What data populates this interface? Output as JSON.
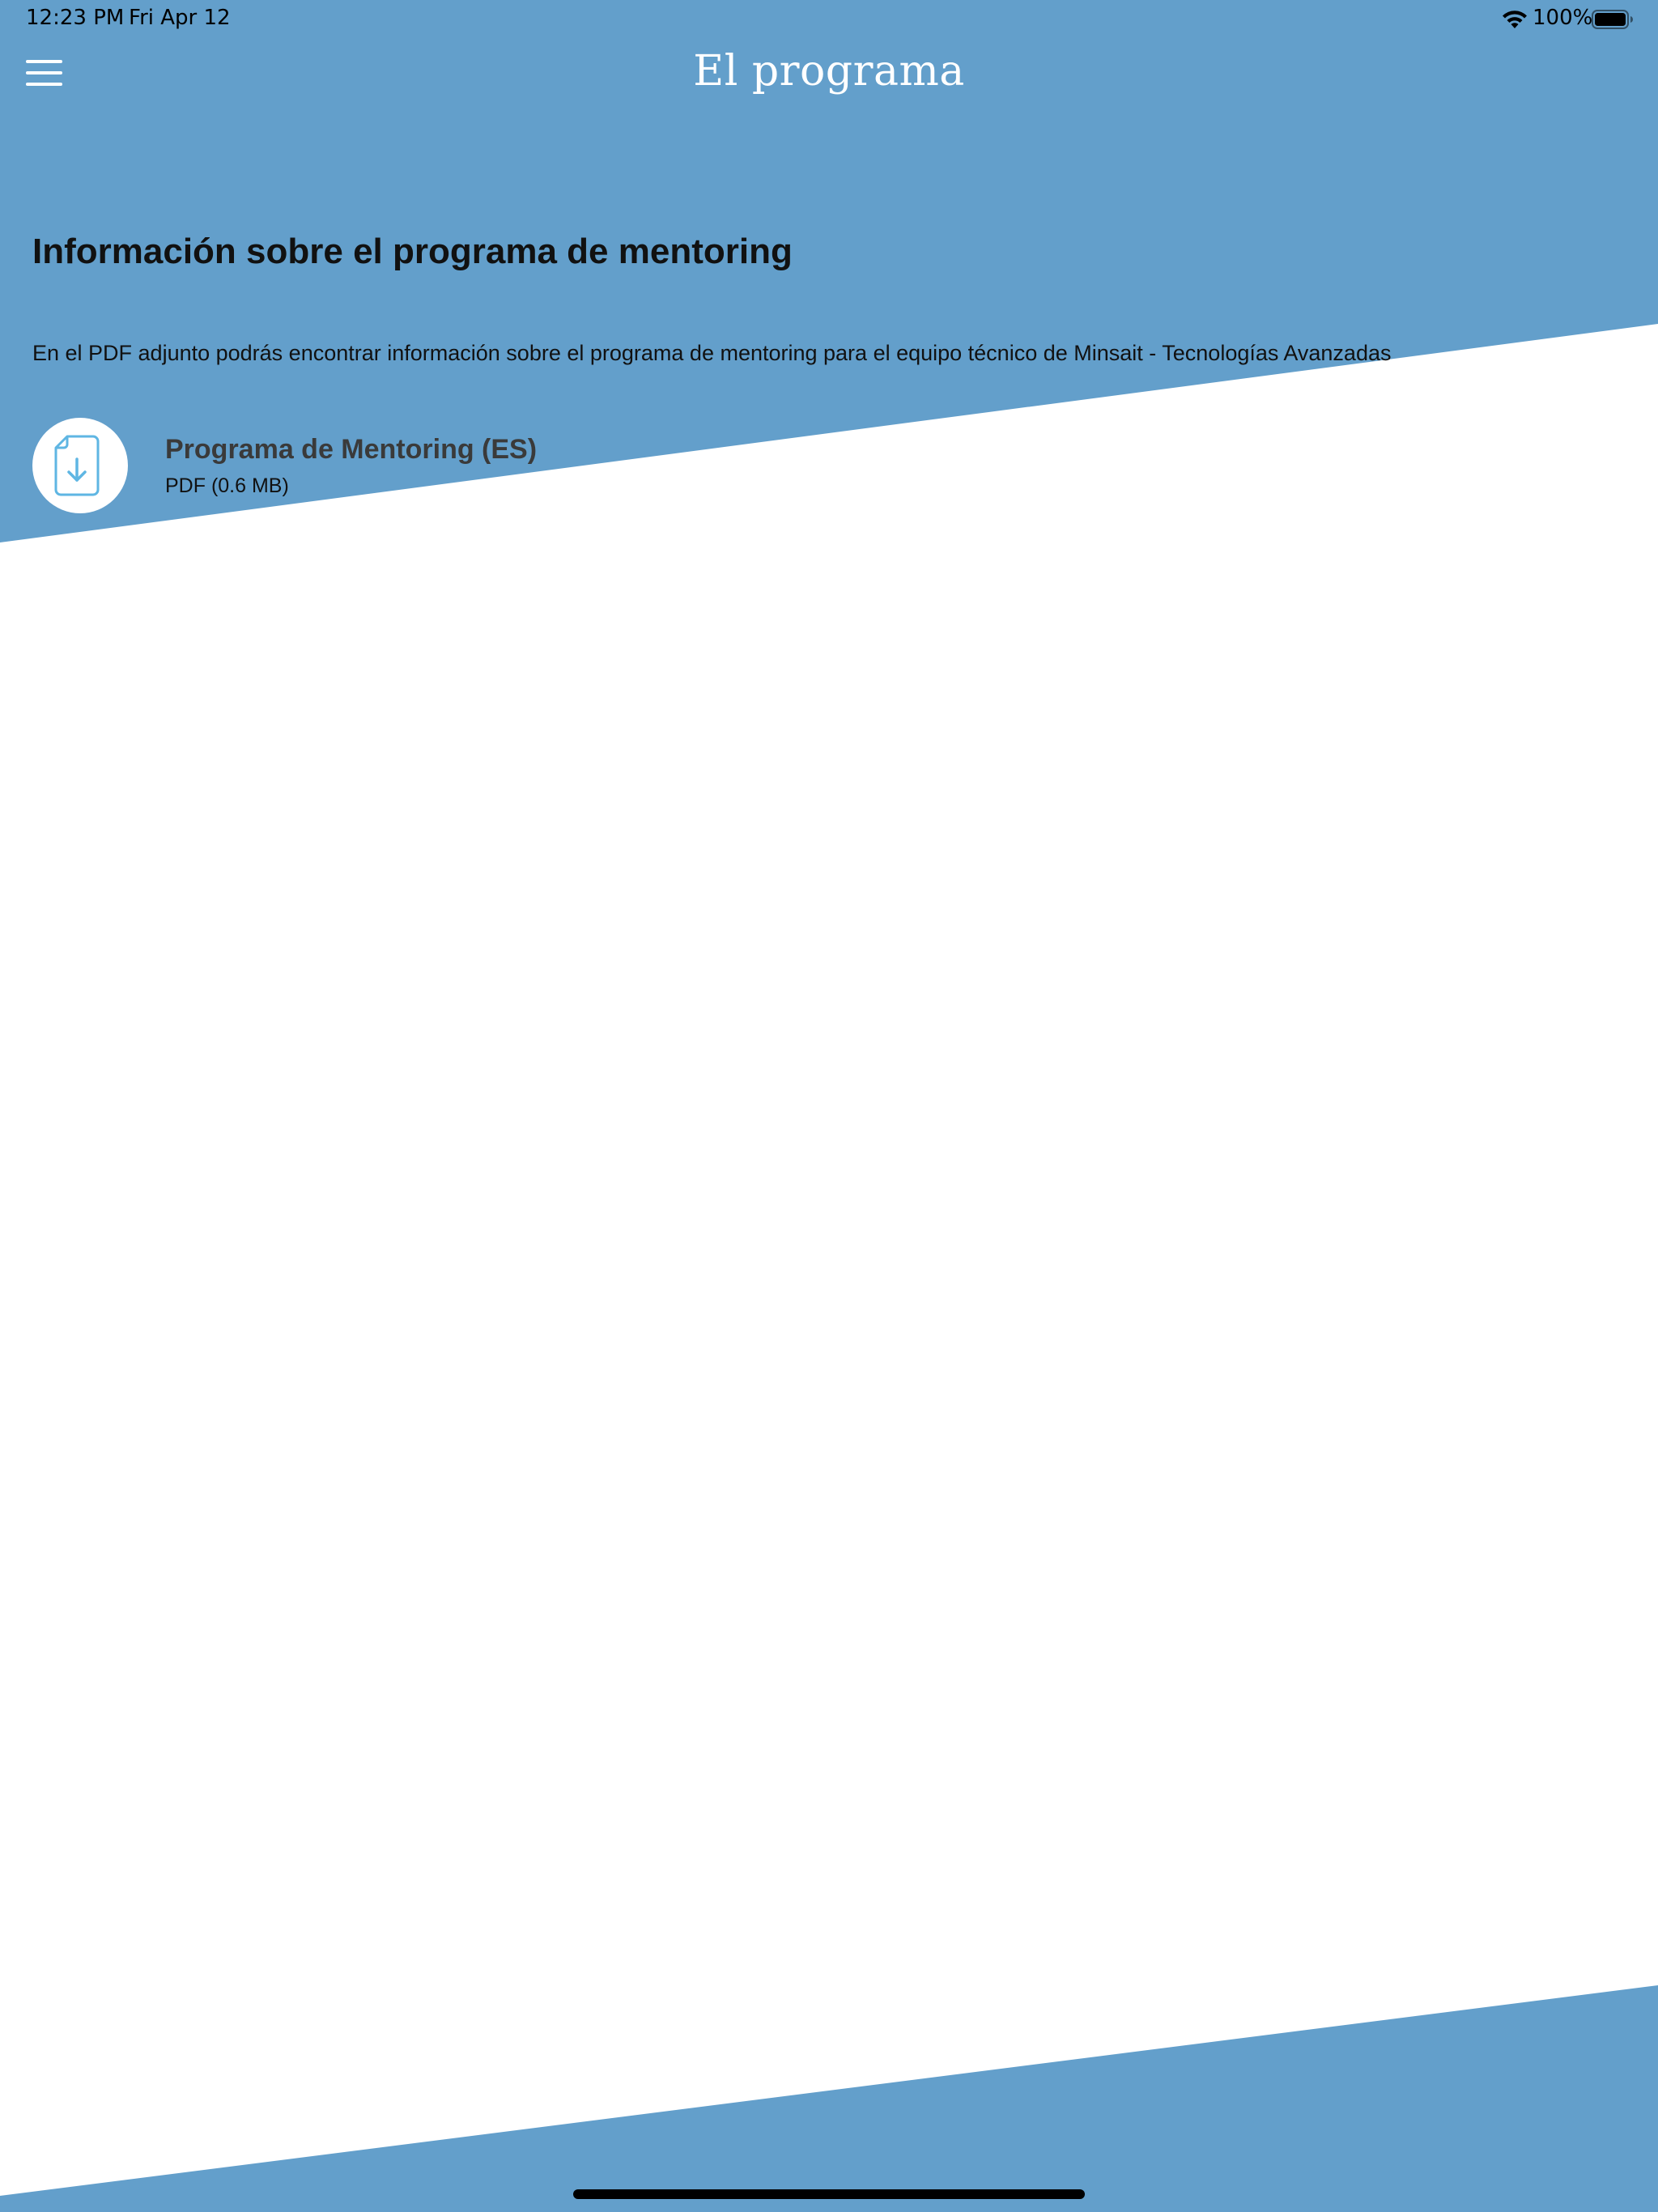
{
  "status_bar": {
    "time": "12:23 PM",
    "date": "Fri Apr 12",
    "battery_percent": "100%",
    "wifi_icon": "wifi-icon",
    "battery_icon": "battery-full-icon"
  },
  "nav": {
    "title": "El programa",
    "menu_icon": "hamburger-menu-icon"
  },
  "content": {
    "heading": "Información sobre el programa de mentoring",
    "description": "En el PDF adjunto podrás encontrar información sobre el programa de mentoring para el equipo técnico de Minsait - Tecnologías Avanzadas",
    "files": [
      {
        "name": "Programa de Mentoring (ES)",
        "meta": "PDF (0.6 MB)",
        "icon": "file-download-icon"
      }
    ]
  },
  "colors": {
    "accent_blue": "#639fcb",
    "icon_blue": "#5fb6e3",
    "background": "#ffffff"
  }
}
